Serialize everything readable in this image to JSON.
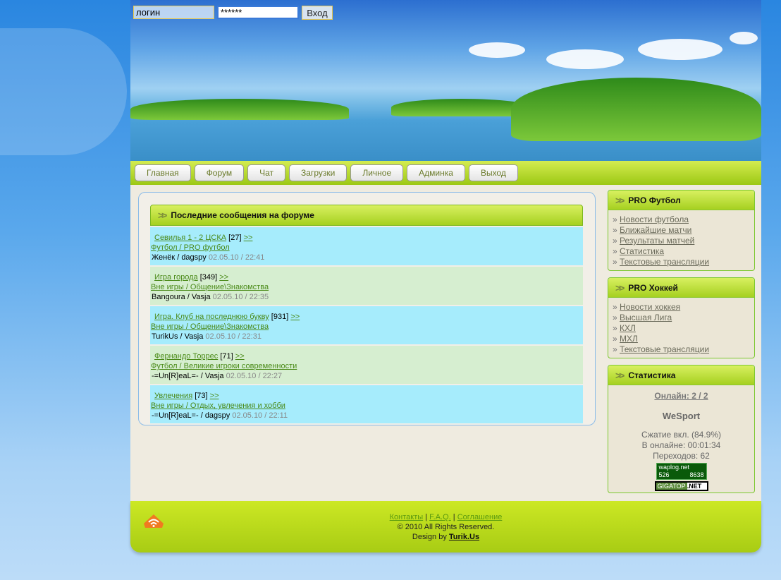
{
  "login": {
    "username_value": "логин",
    "password_value": "******",
    "submit_label": "Вход"
  },
  "nav": [
    "Главная",
    "Форум",
    "Чат",
    "Загрузки",
    "Личное",
    "Админка",
    "Выход"
  ],
  "forum": {
    "title": "Последние сообщения на форуме",
    "posts": [
      {
        "topic": "Севилья 1 - 2 ЦСКА",
        "count": "[27]",
        "more": ">>",
        "category": "Футбол / PRO футбол",
        "authors": "Женёк / dagspy",
        "date": "02.05.10 / 22:41"
      },
      {
        "topic": "Игра города",
        "count": "[349]",
        "more": ">>",
        "category": "Вне игры / Общение\\Знакомства",
        "authors": "Bangoura / Vasja",
        "date": "02.05.10 / 22:35"
      },
      {
        "topic": "Игра. Клуб на последнюю букву",
        "count": "[931]",
        "more": ">>",
        "category": "Вне игры / Общение\\Знакомства",
        "authors": "TurikUs / Vasja",
        "date": "02.05.10 / 22:31"
      },
      {
        "topic": "Фернандо Торрес",
        "count": "[71]",
        "more": ">>",
        "category": "Футбол / Великие игроки современности",
        "authors": "-=Un[R]eaL=- / Vasja",
        "date": "02.05.10 / 22:27"
      },
      {
        "topic": "Увлечения",
        "count": "[73]",
        "more": ">>",
        "category": "Вне игры / Отдых, увлечения и хобби",
        "authors": "-=Un[R]eaL=- / dagspy",
        "date": "02.05.10 / 22:11"
      }
    ]
  },
  "football": {
    "title": "PRO Футбол",
    "items": [
      "Новости футбола",
      "Ближайшие матчи",
      "Результаты матчей",
      "Статистика",
      "Текстовые трансляции"
    ]
  },
  "hockey": {
    "title": "PRO Хоккей",
    "items": [
      "Новости хоккея",
      "Высшая Лига",
      "КХЛ",
      "МХЛ",
      "Текстовые трансляции"
    ]
  },
  "stats": {
    "title": "Статистика",
    "online": "Онлайн: 2 / 2",
    "site": "WeSport",
    "compression": "Сжатие вкл. (84.9%)",
    "time_online": "В онлайне: 00:01:34",
    "visits": "Переходов: 62",
    "counter1_name": "waplog.net",
    "counter1_a": "526",
    "counter1_b": "8638",
    "counter2_name": "GIGATOP",
    "counter2_suffix": ".NET"
  },
  "footer": {
    "links": [
      "Контакты",
      "F.A.Q.",
      "Соглашение"
    ],
    "copyright": "© 2010 All Rights Reserved.",
    "design_by": "Design by",
    "designer": "Turik.Us"
  },
  "bullet": "»"
}
